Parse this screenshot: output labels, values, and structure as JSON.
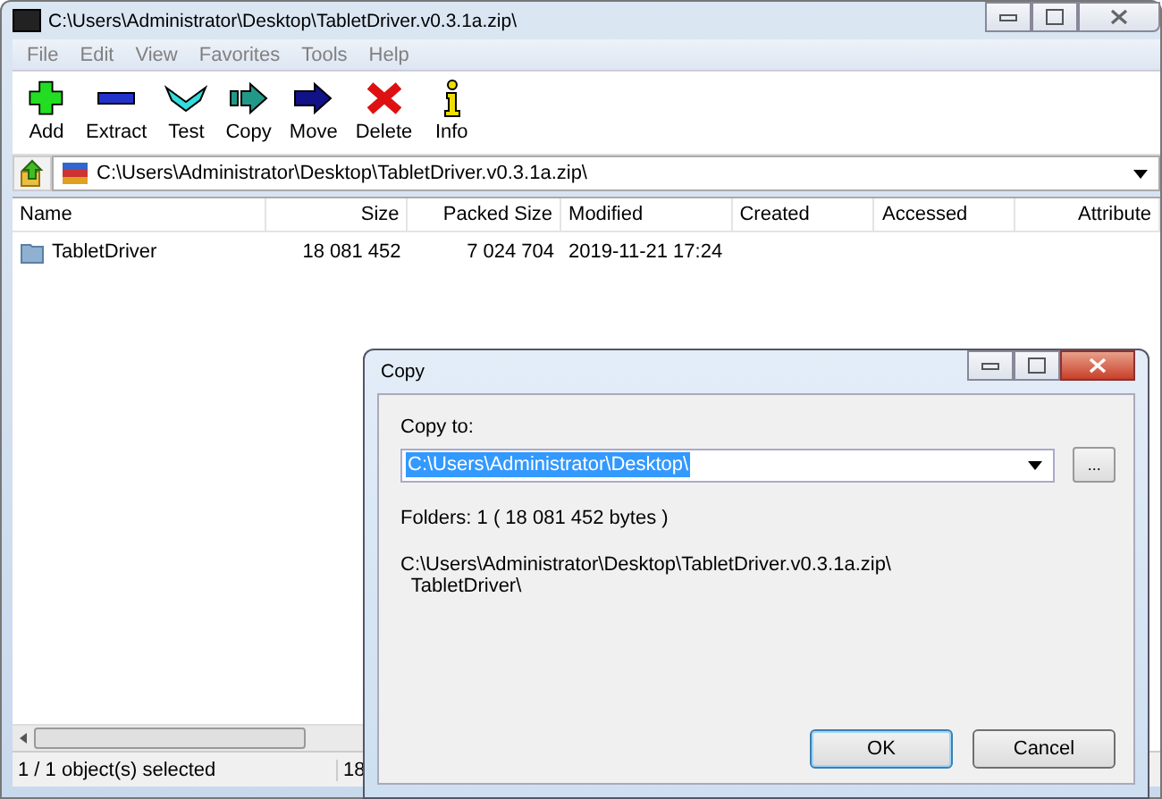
{
  "window": {
    "title": "C:\\Users\\Administrator\\Desktop\\TabletDriver.v0.3.1a.zip\\"
  },
  "menu": [
    "File",
    "Edit",
    "View",
    "Favorites",
    "Tools",
    "Help"
  ],
  "toolbar": [
    {
      "kind": "add",
      "label": "Add"
    },
    {
      "kind": "extract",
      "label": "Extract"
    },
    {
      "kind": "test",
      "label": "Test"
    },
    {
      "kind": "copy",
      "label": "Copy"
    },
    {
      "kind": "move",
      "label": "Move"
    },
    {
      "kind": "delete",
      "label": "Delete"
    },
    {
      "kind": "info",
      "label": "Info"
    }
  ],
  "address": "C:\\Users\\Administrator\\Desktop\\TabletDriver.v0.3.1a.zip\\",
  "table": {
    "columns": [
      "Name",
      "Size",
      "Packed Size",
      "Modified",
      "Created",
      "Accessed",
      "Attribute"
    ],
    "rows": [
      {
        "cells": [
          "TabletDriver",
          "18 081 452",
          "7 024 704",
          "2019-11-21 17:24",
          "",
          "",
          ""
        ]
      }
    ]
  },
  "status_bar": [
    "1 / 1 object(s) selected",
    "18"
  ],
  "dialog": {
    "title": "Copy",
    "label": "Copy to:",
    "value": "C:\\Users\\Administrator\\Desktop\\",
    "browse": "...",
    "info": "Folders: 1    ( 18 081 452 bytes )",
    "paths": [
      "C:\\Users\\Administrator\\Desktop\\TabletDriver.v0.3.1a.zip\\",
      "  TabletDriver\\"
    ],
    "buttons": [
      "OK",
      "Cancel"
    ]
  }
}
